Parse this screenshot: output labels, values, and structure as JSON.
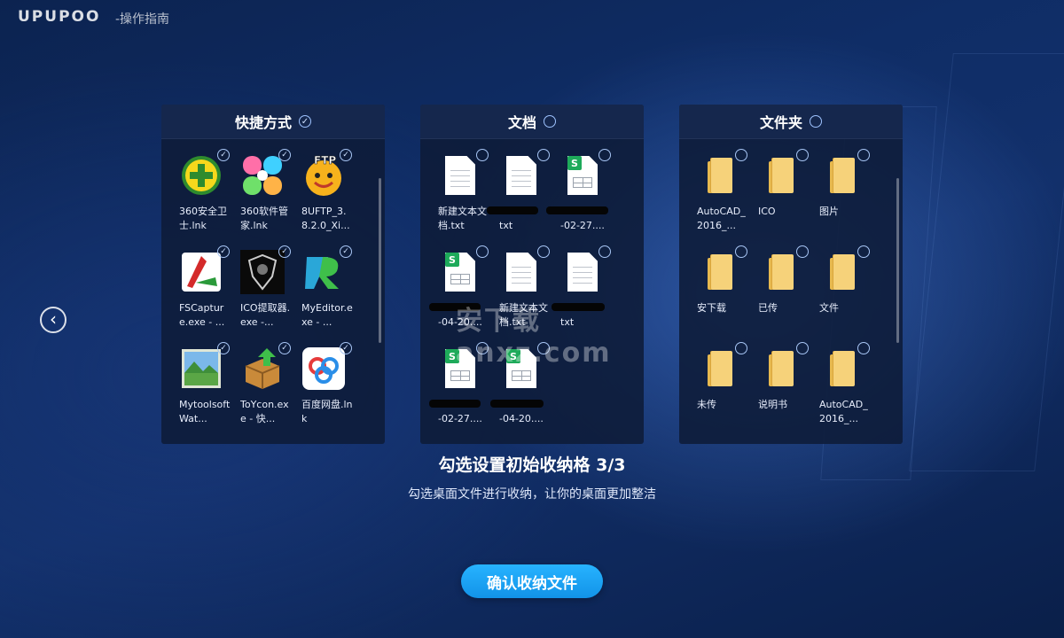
{
  "app": {
    "logo": "UPUPOO",
    "page_title": "-操作指南"
  },
  "panels": [
    {
      "title": "快捷方式",
      "checked": true,
      "items": [
        {
          "icon": "shield-plus-icon",
          "label": "360安全卫士.lnk",
          "checked": true
        },
        {
          "icon": "flower-icon",
          "label": "360软件管家.lnk",
          "checked": true
        },
        {
          "icon": "ftp-smiley-icon",
          "label": "8UFTP_3.8.2.0_Xi...",
          "checked": true
        },
        {
          "icon": "fscapture-icon",
          "label": "FSCapture.exe - ...",
          "checked": true
        },
        {
          "icon": "ico-extract-icon",
          "label": "ICO提取器.exe -...",
          "checked": true
        },
        {
          "icon": "myeditor-icon",
          "label": "MyEditor.exe - ...",
          "checked": true
        },
        {
          "icon": "landscape-icon",
          "label": "Mytoolsoft Wat...",
          "checked": true
        },
        {
          "icon": "box-arrow-icon",
          "label": "ToYcon.exe - 快...",
          "checked": true
        },
        {
          "icon": "cloud-disk-icon",
          "label": "百度网盘.lnk",
          "checked": true
        }
      ]
    },
    {
      "title": "文档",
      "checked": false,
      "items": [
        {
          "icon": "text-doc-icon",
          "label": "新建文本文档.txt",
          "checked": false
        },
        {
          "icon": "text-doc-icon",
          "label": "txt",
          "checked": false
        },
        {
          "icon": "spreadsheet-icon",
          "label": "-02-27....",
          "checked": false
        },
        {
          "icon": "spreadsheet-icon",
          "label": "-04-20....",
          "checked": false
        },
        {
          "icon": "text-doc-icon",
          "label": "新建文本文档.txt",
          "checked": false
        },
        {
          "icon": "text-doc-icon",
          "label": "txt",
          "checked": false
        },
        {
          "icon": "spreadsheet-icon",
          "label": "-02-27....",
          "checked": false
        },
        {
          "icon": "spreadsheet-icon",
          "label": "-04-20....",
          "checked": false
        }
      ]
    },
    {
      "title": "文件夹",
      "checked": false,
      "items": [
        {
          "icon": "folder-icon",
          "label": "AutoCAD_2016_...",
          "checked": false
        },
        {
          "icon": "folder-icon",
          "label": "ICO",
          "checked": false
        },
        {
          "icon": "folder-icon",
          "label": "图片",
          "checked": false
        },
        {
          "icon": "folder-icon",
          "label": "安下载",
          "checked": false
        },
        {
          "icon": "folder-icon",
          "label": "已传",
          "checked": false
        },
        {
          "icon": "folder-icon",
          "label": "文件",
          "checked": false
        },
        {
          "icon": "folder-icon",
          "label": "未传",
          "checked": false
        },
        {
          "icon": "folder-icon",
          "label": "说明书",
          "checked": false
        },
        {
          "icon": "folder-icon",
          "label": "AutoCAD_2016_...",
          "checked": false
        }
      ]
    }
  ],
  "step": {
    "title": "勾选设置初始收纳格 3/3",
    "description": "勾选桌面文件进行收纳，让你的桌面更加整洁"
  },
  "buttons": {
    "confirm": "确认收纳文件",
    "prev": "‹"
  },
  "watermark": "安下载 anxz.com",
  "colors": {
    "accent": "#1a9ff0",
    "panel_bg": "#0e1b38",
    "check": "#a8c6f5"
  }
}
